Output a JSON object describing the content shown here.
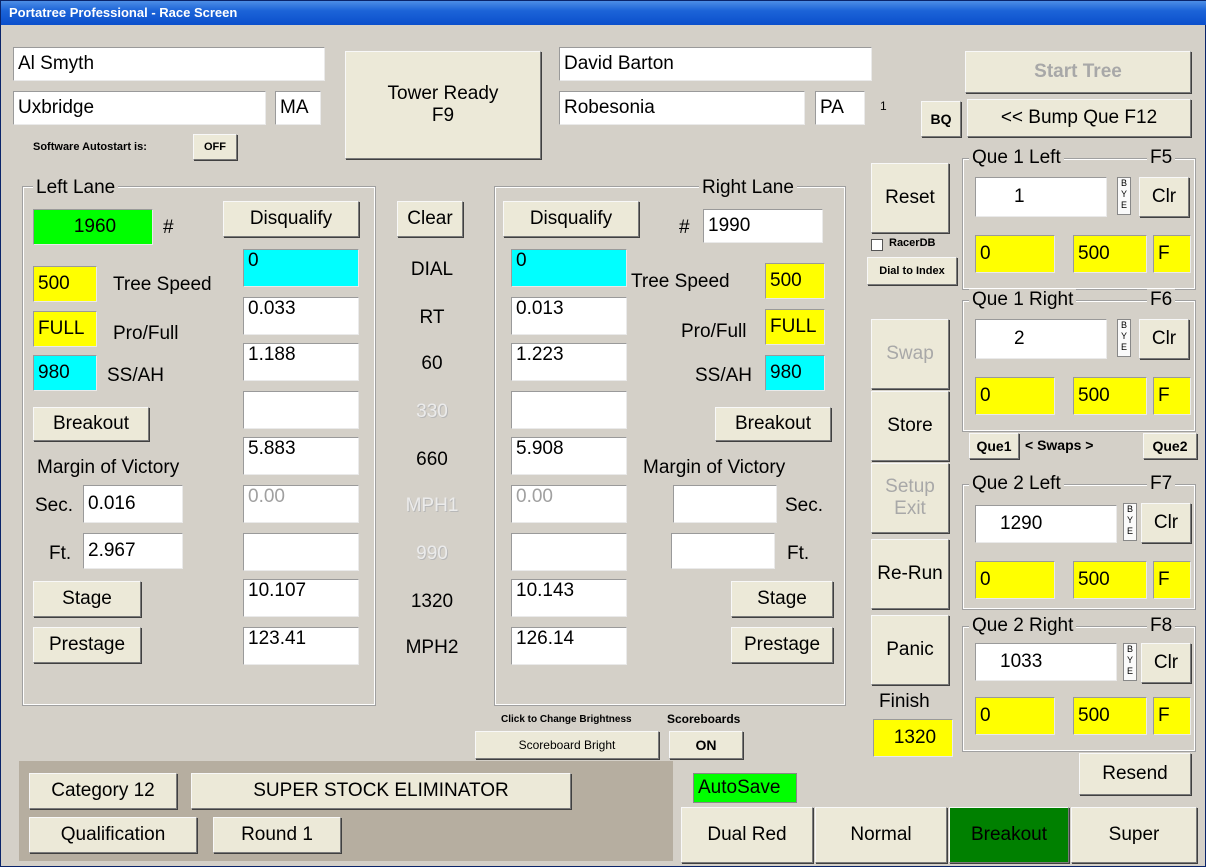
{
  "window": {
    "title": "Portatree Professional - Race Screen"
  },
  "left_racer": {
    "name": "Al Smyth",
    "city": "Uxbridge",
    "state": "MA"
  },
  "right_racer": {
    "name": "David Barton",
    "city": "Robesonia",
    "state": "PA",
    "count": "1"
  },
  "tower": {
    "label": "Tower Ready",
    "key": "F9"
  },
  "autostart": {
    "label": "Software Autostart is:",
    "value": "OFF"
  },
  "left_lane": {
    "title": "Left Lane",
    "number": "1960",
    "hash": "#",
    "disqualify": "Disqualify",
    "tree_speed": "500",
    "tree_speed_label": "Tree Speed",
    "pro_full": "FULL",
    "pro_full_label": "Pro/Full",
    "ss_ah": "980",
    "ss_ah_label": "SS/AH",
    "breakout": "Breakout",
    "mov_label": "Margin of Victory",
    "sec_label": "Sec.",
    "sec_value": "0.016",
    "ft_label": "Ft.",
    "ft_value": "2.967",
    "stage": "Stage",
    "prestage": "Prestage",
    "dial": "0",
    "rt": "0.033",
    "sixty": "1.188",
    "t330": "",
    "t660": "5.883",
    "mph1": "0.00",
    "t990": "",
    "t1320": "10.107",
    "mph2": "123.41"
  },
  "right_lane": {
    "title": "Right Lane",
    "number": "1990",
    "hash": "#",
    "disqualify": "Disqualify",
    "tree_speed": "500",
    "tree_speed_label": "Tree Speed",
    "pro_full": "FULL",
    "pro_full_label": "Pro/Full",
    "ss_ah": "980",
    "ss_ah_label": "SS/AH",
    "breakout": "Breakout",
    "mov_label": "Margin of Victory",
    "sec_label": "Sec.",
    "sec_value": "",
    "ft_label": "Ft.",
    "ft_value": "",
    "stage": "Stage",
    "prestage": "Prestage",
    "dial": "0",
    "rt": "0.013",
    "sixty": "1.223",
    "t330": "",
    "t660": "5.908",
    "mph1": "0.00",
    "t990": "",
    "t1320": "10.143",
    "mph2": "126.14"
  },
  "center": {
    "clear": "Clear",
    "dial": "DIAL",
    "rt": "RT",
    "sixty": "60",
    "t330": "330",
    "t660": "660",
    "mph1": "MPH1",
    "t990": "990",
    "t1320": "1320",
    "mph2": "MPH2"
  },
  "middle_controls": {
    "reset": "Reset",
    "racerdb": "RacerDB",
    "dial_to_index": "Dial to Index",
    "swap": "Swap",
    "store": "Store",
    "setup_exit_1": "Setup",
    "setup_exit_2": "Exit",
    "rerun": "Re-Run",
    "panic": "Panic",
    "finish_label": "Finish",
    "finish_value": "1320"
  },
  "start_tree": "Start Tree",
  "bq": "BQ",
  "bump_que": "<< Bump Que  F12",
  "swaps": {
    "que1": "Que1",
    "label": "< Swaps >",
    "que2": "Que2"
  },
  "queues": [
    {
      "title": "Que 1 Left",
      "key": "F5",
      "number": "1",
      "bye": "BYE",
      "clr": "Clr",
      "v1": "0",
      "v2": "500",
      "v3": "F"
    },
    {
      "title": "Que 1 Right",
      "key": "F6",
      "number": "2",
      "bye": "BYE",
      "clr": "Clr",
      "v1": "0",
      "v2": "500",
      "v3": "F"
    },
    {
      "title": "Que 2 Left",
      "key": "F7",
      "number": "1290",
      "bye": "BYE",
      "clr": "Clr",
      "v1": "0",
      "v2": "500",
      "v3": "F"
    },
    {
      "title": "Que 2 Right",
      "key": "F8",
      "number": "1033",
      "bye": "BYE",
      "clr": "Clr",
      "v1": "0",
      "v2": "500",
      "v3": "F"
    }
  ],
  "scoreboard": {
    "hint": "Click to Change Brightness",
    "label": "Scoreboards",
    "bright": "Scoreboard Bright",
    "state": "ON"
  },
  "event": {
    "category": "Category 12",
    "eliminator": "SUPER STOCK ELIMINATOR",
    "qualification": "Qualification",
    "round": "Round 1"
  },
  "autosave": "AutoSave",
  "resend": "Resend",
  "modes": {
    "dual_red": "Dual Red",
    "normal": "Normal",
    "breakout": "Breakout",
    "super": "Super"
  },
  "colors": {
    "yellow": "#ffff00",
    "cyan": "#00ffff",
    "green": "#00ff00",
    "dark_green": "#008000",
    "titlebar": "#0b4fcc"
  }
}
